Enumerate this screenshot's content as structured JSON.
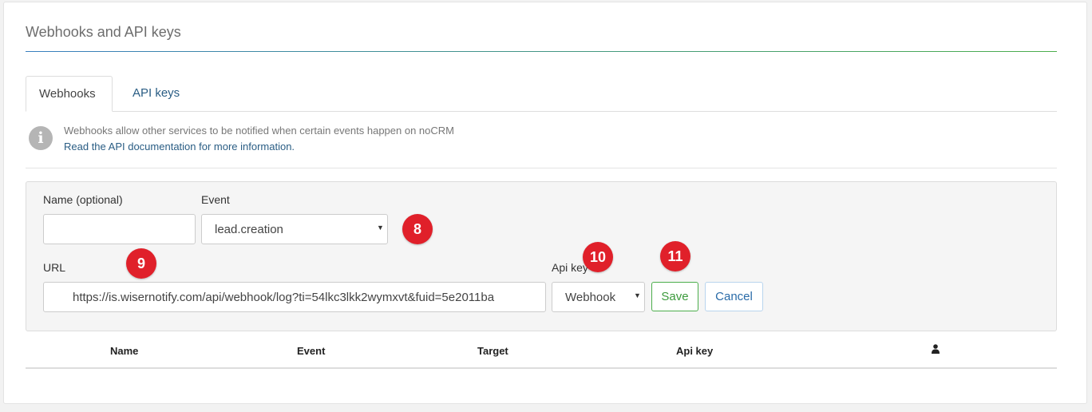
{
  "panel": {
    "title": "Webhooks and API keys"
  },
  "tabs": [
    {
      "label": "Webhooks",
      "active": true
    },
    {
      "label": "API keys",
      "active": false
    }
  ],
  "info": {
    "icon": "info-icon",
    "text": "Webhooks allow other services to be notified when certain events happen on noCRM",
    "link": "Read the API documentation for more information."
  },
  "form": {
    "name": {
      "label": "Name (optional)",
      "value": ""
    },
    "event": {
      "label": "Event",
      "value": "lead.creation"
    },
    "url": {
      "label": "URL",
      "value": "https://is.wisernotify.com/api/webhook/log?ti=54lkc3lkk2wymxvt&fuid=5e2011ba"
    },
    "api_key": {
      "label": "Api key",
      "value": "Webhook"
    },
    "save_label": "Save",
    "cancel_label": "Cancel"
  },
  "annotations": {
    "b8": "8",
    "b9": "9",
    "b10": "10",
    "b11": "11",
    "color": "#e0202a"
  },
  "table": {
    "columns": [
      "Name",
      "Event",
      "Target",
      "Api key"
    ],
    "user_column_icon": "user-icon"
  },
  "colors": {
    "link": "#2a5d84",
    "save": "#4cae4c",
    "accent_gradient": [
      "#3a7fbf",
      "#4cae4c"
    ]
  }
}
